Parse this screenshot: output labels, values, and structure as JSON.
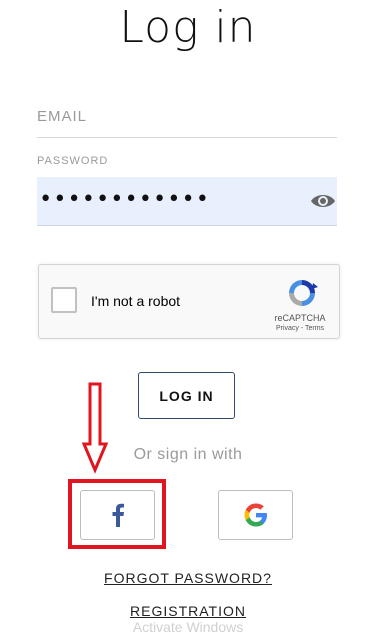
{
  "page": {
    "title": "Log in"
  },
  "form": {
    "email_label": "EMAIL",
    "email_value": "",
    "password_label": "PASSWORD",
    "password_value": "••••••••••••"
  },
  "captcha": {
    "label": "I'm not a robot",
    "brand": "reCAPTCHA",
    "links": "Privacy - Terms",
    "checked": false
  },
  "actions": {
    "login_label": "LOG IN",
    "or_sign_in": "Or sign in with",
    "forgot_password": "FORGOT PASSWORD?",
    "registration": "REGISTRATION",
    "faded_text": "Activate Windows"
  },
  "social": {
    "facebook_color": "#3b5998",
    "google_colors": [
      "#4285F4",
      "#EA4335",
      "#FBBC05",
      "#34A853"
    ]
  },
  "annotation": {
    "color": "#e0151f"
  }
}
